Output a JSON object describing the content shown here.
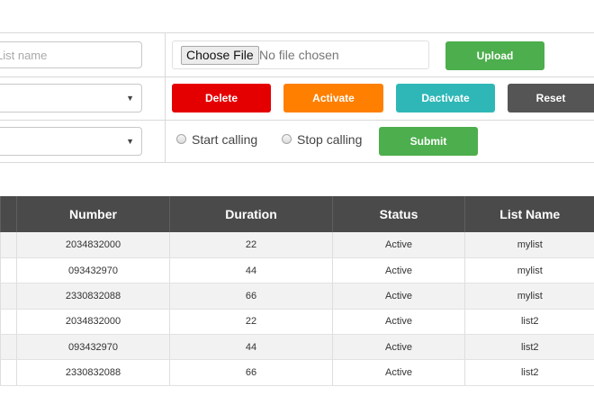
{
  "form": {
    "list_name_placeholder": "List name",
    "choose_file_label": "Choose File",
    "file_status": "No file chosen",
    "upload_label": "Upload",
    "delete_label": "Delete",
    "activate_label": "Activate",
    "deactivate_label": "Dactivate",
    "reset_label": "Reset",
    "radio_start": "Start calling",
    "radio_stop": "Stop calling",
    "submit_label": "Submit"
  },
  "colors": {
    "upload": "#4cae4c",
    "delete": "#e40000",
    "activate": "#ff7f00",
    "deactivate": "#2fb7b7",
    "reset": "#555555",
    "submit": "#4cae4c",
    "table_header": "#4a4a4a"
  },
  "table": {
    "headers": [
      "Number",
      "Duration",
      "Status",
      "List Name"
    ],
    "rows": [
      [
        "2034832000",
        "22",
        "Active",
        "mylist"
      ],
      [
        "093432970",
        "44",
        "Active",
        "mylist"
      ],
      [
        "2330832088",
        "66",
        "Active",
        "mylist"
      ],
      [
        "2034832000",
        "22",
        "Active",
        "list2"
      ],
      [
        "093432970",
        "44",
        "Active",
        "list2"
      ],
      [
        "2330832088",
        "66",
        "Active",
        "list2"
      ]
    ]
  }
}
